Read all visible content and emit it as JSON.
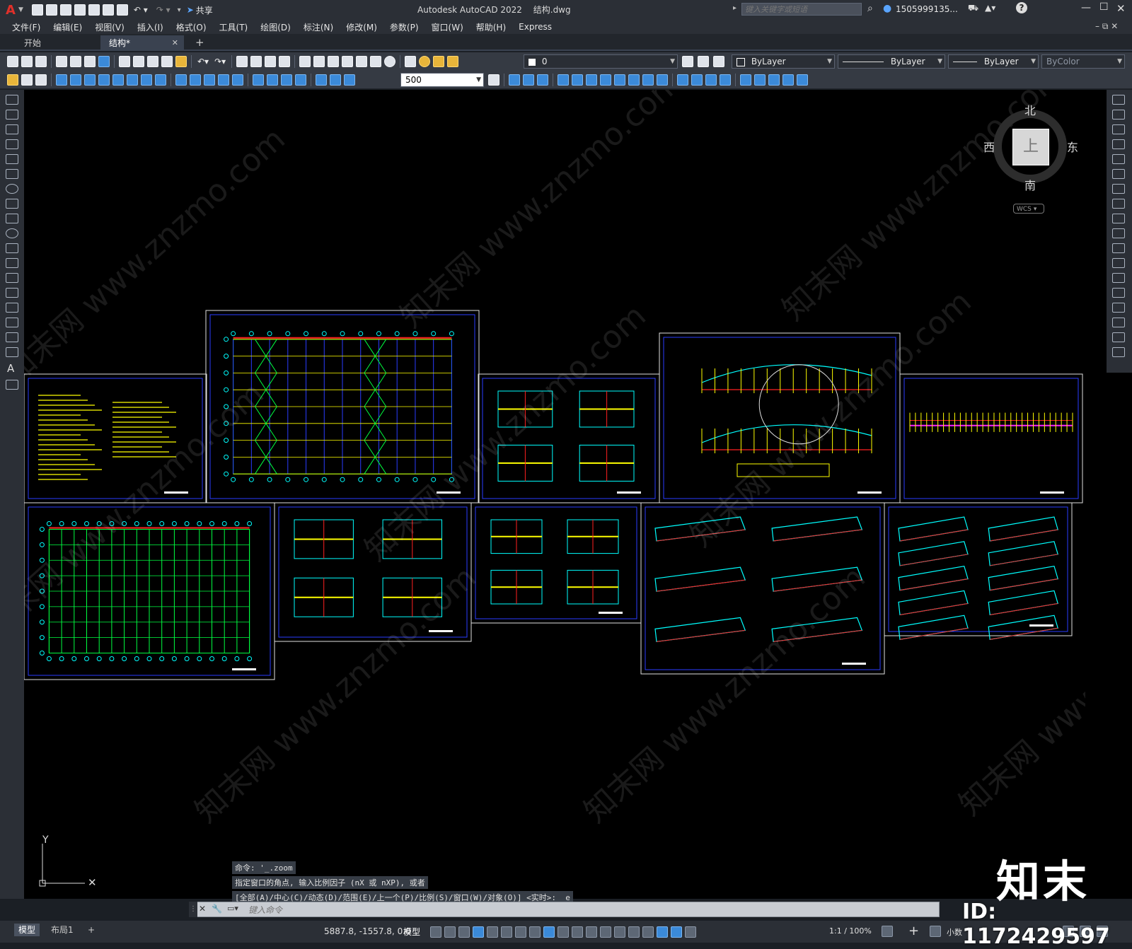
{
  "titlebar": {
    "app_title": "Autodesk AutoCAD 2022",
    "file_name": "结构.dwg",
    "share_label": "共享",
    "search_placeholder": "键入关键字或短语",
    "user_label": "1505999135...",
    "app_letter": "A"
  },
  "menu": {
    "items": [
      "文件(F)",
      "编辑(E)",
      "视图(V)",
      "插入(I)",
      "格式(O)",
      "工具(T)",
      "绘图(D)",
      "标注(N)",
      "修改(M)",
      "参数(P)",
      "窗口(W)",
      "帮助(H)",
      "Express"
    ]
  },
  "tabs": {
    "start": "开始",
    "active": "结构*",
    "close": "✕",
    "add": "+"
  },
  "toolbar": {
    "layer_value": "0",
    "color_value": "ByLayer",
    "linetype_value": "ByLayer",
    "lineweight_value": "ByLayer",
    "plotstyle_value": "ByColor",
    "dim_value": "500"
  },
  "viewcube": {
    "north": "北",
    "south": "南",
    "west": "西",
    "east": "东",
    "top": "上",
    "wcs": "WCS"
  },
  "ucs": {
    "y": "Y"
  },
  "command": {
    "history": [
      "命令: '_.zoom",
      "指定窗口的角点, 输入比例因子 (nX 或 nXP), 或者",
      "[全部(A)/中心(C)/动态(D)/范围(E)/上一个(P)/比例(S)/窗口(W)/对象(O)] <实时>: _e"
    ],
    "placeholder": "键入命令"
  },
  "statusbar": {
    "tab_model": "模型",
    "tab_layout": "布局1",
    "add": "+",
    "coords": "5887.8, -1557.8, 0.0",
    "mode": "模型",
    "scale": "1:1 / 100%",
    "units": "小数"
  },
  "watermark": {
    "text": "知末网 www.znzmo.com",
    "brand": "知末",
    "id": "ID: 1172429597"
  },
  "colors": {
    "canvas": "#000000",
    "ui_dark": "#2b2f36",
    "toolbar": "#353a43",
    "frame_blue": "#2a3cff",
    "cad_yellow": "#ffff00",
    "cad_green": "#00ff40",
    "cad_cyan": "#00ffff",
    "cad_red": "#ff2020",
    "cad_magenta": "#ff20ff"
  }
}
